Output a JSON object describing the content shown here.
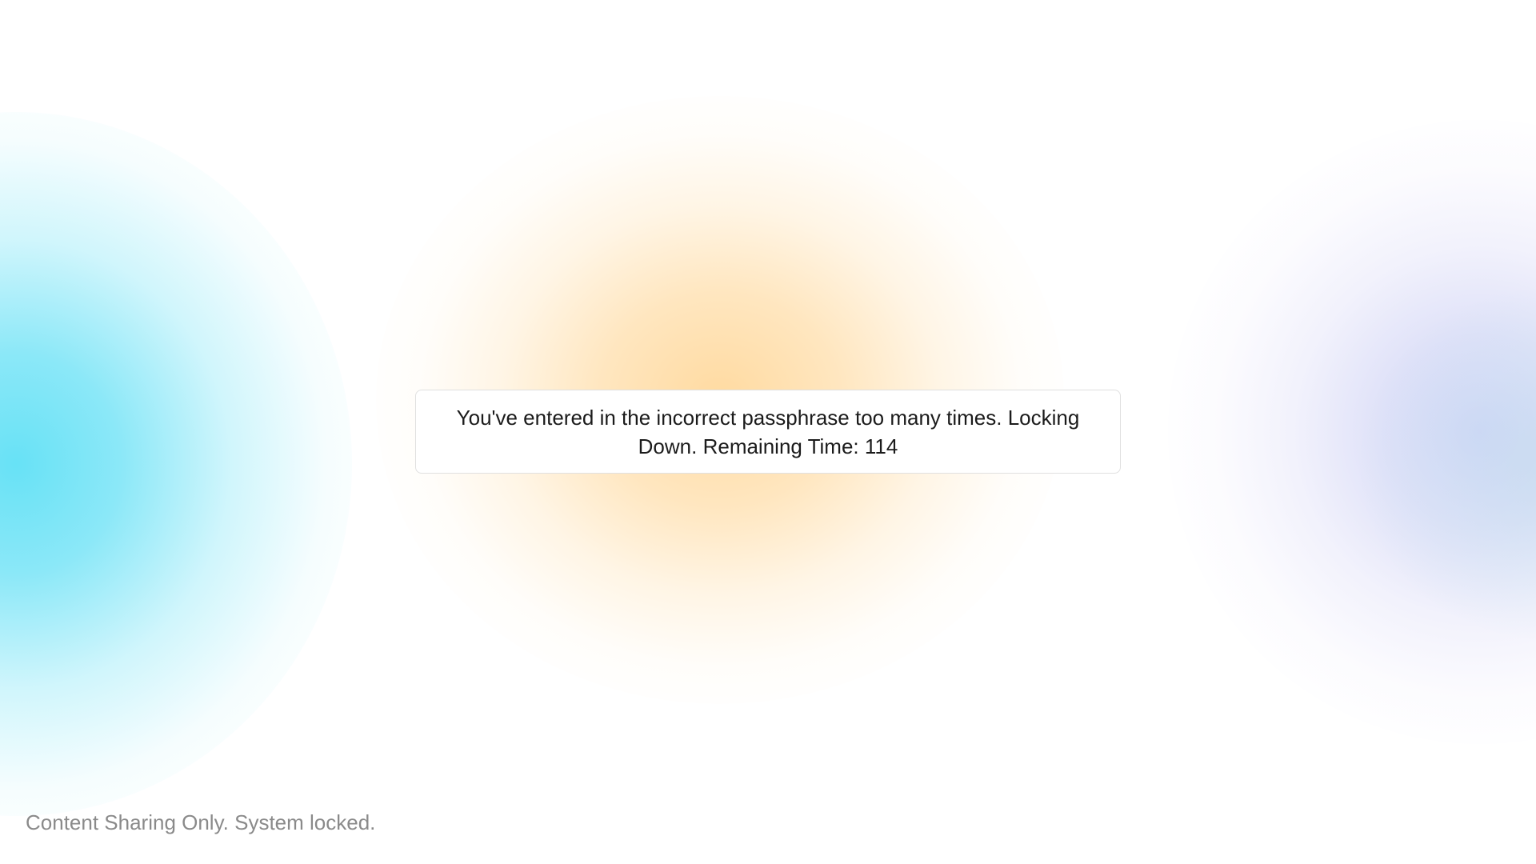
{
  "lock_dialog": {
    "message": "You've entered in the incorrect passphrase too many times. Locking Down. Remaining Time: 114",
    "remaining_time": 114
  },
  "footer": {
    "status_text": "Content Sharing Only. System locked."
  },
  "colors": {
    "background": "#ffffff",
    "glow_left": "#5fe0f5",
    "glow_center": "#ffd696",
    "glow_right": "#cdd2f6",
    "message_text": "#1b1b1b",
    "footer_text": "#8a8a8a"
  }
}
